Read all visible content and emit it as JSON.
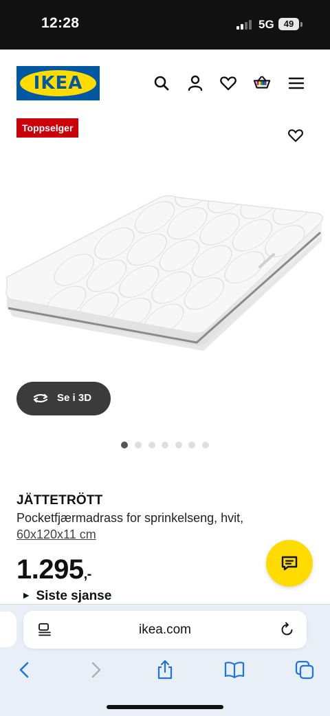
{
  "status_bar": {
    "time": "12:28",
    "network": "5G",
    "battery": "49"
  },
  "header": {
    "logo_text": "IKEA",
    "icons": [
      "search-icon",
      "account-icon",
      "heart-icon",
      "cart-icon",
      "menu-icon"
    ]
  },
  "product": {
    "badge": "Toppselger",
    "view_3d_label": "Se i 3D",
    "gallery_image_count": 7,
    "gallery_active_index": 0,
    "name": "JÄTTETRÖTT",
    "description": "Pocketfjærmadrass for sprinkelseng, hvit,",
    "dimensions": "60x120x11 cm",
    "price": "1.295",
    "price_suffix": ",-",
    "last_chance": "Siste sjanse"
  },
  "browser": {
    "url": "ikea.com"
  },
  "colors": {
    "ikea_blue": "#0058a3",
    "ikea_yellow": "#ffdb00",
    "badge_red": "#cc0008",
    "ios_blue": "#1a73e8"
  }
}
